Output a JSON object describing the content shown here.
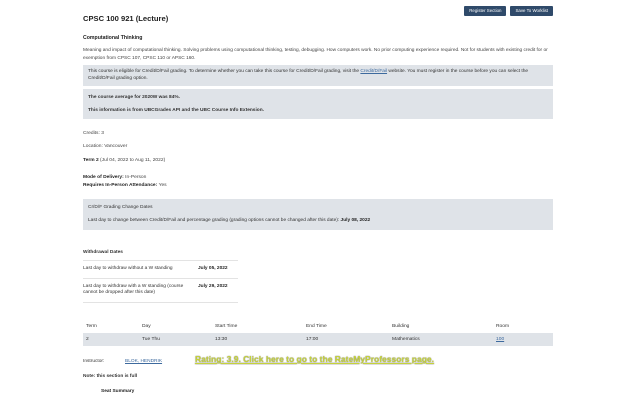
{
  "header": {
    "title": "CPSC 100 921 (Lecture)",
    "register_button": "Register Section",
    "worklist_button": "Save To Worklist"
  },
  "course": {
    "subtitle": "Computational Thinking",
    "description": "Meaning and impact of computational thinking. Solving problems using computational thinking, testing, debugging. How computers work. No prior computing experience required. Not for students with existing credit for or exemption from CPSC 107, CPSC 110 or APSC 160."
  },
  "credit_notice": {
    "part1": "This course is eligible for Credit/D/Fail grading. To determine whether you can take this course for Credit/D/Fail grading, visit the ",
    "link": "Credit/D/Fail",
    "part2": " website. You must register in the course before you can select the Credit/D/Fail grading option."
  },
  "average_box": {
    "line1": "The course average for 2020W was 84%.",
    "line2": "This information is from UBCGrades API and the UBC Course Info Extension."
  },
  "details": {
    "credits": "Credits: 3",
    "location": "Location: Vancouver",
    "term_label": "Term 2",
    "term_dates": " (Jul 04, 2022 to Aug 11, 2022)",
    "delivery_label": "Mode of Delivery: ",
    "delivery_value": "In-Person",
    "attendance_label": "Requires In-Person Attendance: ",
    "attendance_value": "Yes"
  },
  "grading_change": {
    "title": "Cr/D/F Grading Change Dates",
    "text": "Last day to change between Credit/D/Fail and percentage grading (grading options cannot be changed after this date): ",
    "date": "July 08, 2022"
  },
  "withdrawal": {
    "title": "Withdrawal Dates",
    "row1_label": "Last day to withdraw without a W standing",
    "row1_date": "July 05, 2022",
    "row2_label": "Last day to withdraw with a W standing (course cannot be dropped after this date)",
    "row2_date": "July 29, 2022"
  },
  "schedule": {
    "headers": [
      "Term",
      "Day",
      "Start Time",
      "End Time",
      "Building",
      "Room"
    ],
    "row": [
      "2",
      "Tue Thu",
      "13:30",
      "17:00",
      "Mathematics",
      "100"
    ]
  },
  "instructor": {
    "label": "Instructor:",
    "name": "BLOK, HENDRIK",
    "rating": "Rating: 3.9. Click here to go to the RateMyProfessors page."
  },
  "note": "Note: this section is full",
  "seat_summary": "Seat Summary",
  "colors": {
    "button_bg": "#2f4a6a",
    "box_bg": "#dfe3e8",
    "rating": "#c6d33a"
  }
}
